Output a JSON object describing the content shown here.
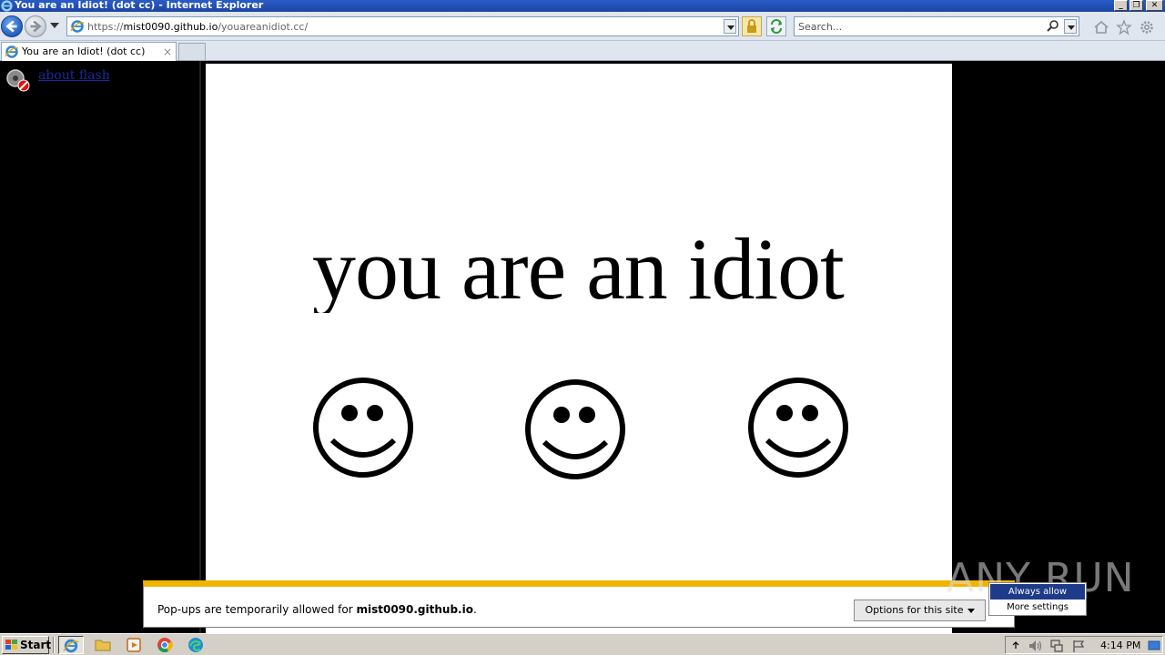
{
  "window": {
    "title": "You are an Idiot! (dot cc) - Internet Explorer"
  },
  "nav": {
    "url_prefix": "https://",
    "url_host": "mist0090.github.io",
    "url_path": "/youareanidiot.cc/",
    "search_placeholder": "Search..."
  },
  "tabs": [
    {
      "label": "You are an Idiot! (dot cc)",
      "close": "×"
    }
  ],
  "page": {
    "plugin_link": "about flash",
    "headline": "you are an idiot!"
  },
  "infobar": {
    "message_prefix": "Pop-ups are temporarily allowed for ",
    "message_site": "mist0090.github.io",
    "message_suffix": ".",
    "options_label": "Options for this site",
    "menu_items": [
      "Always allow",
      "More settings"
    ]
  },
  "watermark": "ANY RUN",
  "taskbar": {
    "start_label": "Start",
    "clock": "4:14 PM"
  },
  "colors": {
    "infobar_accent": "#f0b400",
    "menu_highlight": "#1e3b8a",
    "link": "#1a2a9c"
  }
}
